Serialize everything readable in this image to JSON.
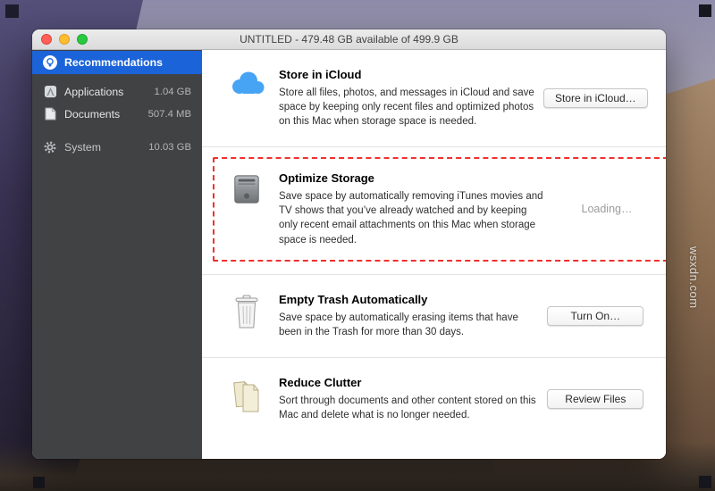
{
  "window": {
    "title": "UNTITLED - 479.48 GB available of 499.9 GB"
  },
  "watermark": "wsxdn.com",
  "sidebar": {
    "items": [
      {
        "label": "Recommendations",
        "size": "",
        "selected": true
      },
      {
        "label": "Applications",
        "size": "1.04 GB",
        "selected": false
      },
      {
        "label": "Documents",
        "size": "507.4 MB",
        "selected": false
      },
      {
        "label": "System",
        "size": "10.03 GB",
        "selected": false
      }
    ]
  },
  "sections": [
    {
      "title": "Store in iCloud",
      "description": "Store all files, photos, and messages in iCloud and save space by keeping only recent files and optimized photos on this Mac when storage space is needed.",
      "action": "Store in iCloud…",
      "action_type": "button"
    },
    {
      "title": "Optimize Storage",
      "description": "Save space by automatically removing iTunes movies and TV shows that you’ve already watched and by keeping only recent email attachments on this Mac when storage space is needed.",
      "action": "Loading…",
      "action_type": "text",
      "highlighted": true
    },
    {
      "title": "Empty Trash Automatically",
      "description": "Save space by automatically erasing items that have been in the Trash for more than 30 days.",
      "action": "Turn On…",
      "action_type": "button"
    },
    {
      "title": "Reduce Clutter",
      "description": "Sort through documents and other content stored on this Mac and delete what is no longer needed.",
      "action": "Review Files",
      "action_type": "button"
    }
  ],
  "colors": {
    "selection_blue": "#1b63d8",
    "highlight_red": "#f03030",
    "icloud_blue": "#47a3f3",
    "sidebar_bg": "#414244",
    "traffic_red": "#ff5f57",
    "traffic_yellow": "#febc2e",
    "traffic_green": "#28c840"
  }
}
